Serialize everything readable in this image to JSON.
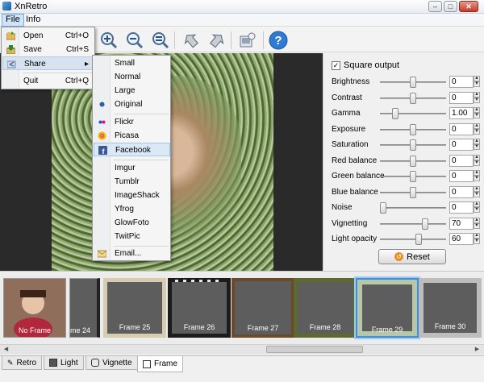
{
  "window": {
    "title": "XnRetro",
    "buttons": [
      "–",
      "□",
      "✕"
    ]
  },
  "menubar": {
    "file": "File",
    "info": "Info"
  },
  "file_menu": [
    {
      "label": "Open",
      "shortcut": "Ctrl+O",
      "icon": "folder-open-icon"
    },
    {
      "label": "Save",
      "shortcut": "Ctrl+S",
      "icon": "save-icon"
    },
    {
      "label": "Share",
      "shortcut": "▸",
      "icon": "share-icon"
    },
    {
      "label": "Quit",
      "shortcut": "Ctrl+Q",
      "icon": ""
    }
  ],
  "share_menu": {
    "sizes": [
      "Small",
      "Normal",
      "Large",
      "Original"
    ],
    "selected_size": "Original",
    "services_a": [
      "Flickr",
      "Picasa",
      "Facebook"
    ],
    "highlighted": "Facebook",
    "services_b": [
      "Imgur",
      "Tumblr",
      "ImageShack",
      "Yfrog",
      "GlowFoto",
      "TwitPic"
    ],
    "email": "Email..."
  },
  "toolbar": [
    "zoom-in-icon",
    "zoom-out-icon",
    "zoom-fit-icon",
    "rotate-left-icon",
    "rotate-right-icon",
    "export-icon",
    "help-icon"
  ],
  "panel": {
    "square_output_label": "Square output",
    "square_output_checked": true,
    "sliders": [
      {
        "label": "Brightness",
        "value": "0",
        "pos": 0.5
      },
      {
        "label": "Contrast",
        "value": "0",
        "pos": 0.5
      },
      {
        "label": "Gamma",
        "value": "1.00",
        "pos": 0.2
      },
      {
        "label": "Exposure",
        "value": "0",
        "pos": 0.5
      },
      {
        "label": "Saturation",
        "value": "0",
        "pos": 0.5
      },
      {
        "label": "Red balance",
        "value": "0",
        "pos": 0.5
      },
      {
        "label": "Green balance",
        "value": "0",
        "pos": 0.5
      },
      {
        "label": "Blue balance",
        "value": "0",
        "pos": 0.5
      },
      {
        "label": "Noise",
        "value": "0",
        "pos": 0.0
      },
      {
        "label": "Vignetting",
        "value": "70",
        "pos": 0.7
      },
      {
        "label": "Light opacity",
        "value": "60",
        "pos": 0.6
      }
    ],
    "reset_label": "Reset"
  },
  "frames": {
    "items": [
      "No Frame",
      "me 24",
      "Frame 25",
      "Frame 26",
      "Frame 27",
      "Frame 28",
      "Frame 29",
      "Frame 30"
    ],
    "selected": "Frame 29"
  },
  "tabs": [
    {
      "label": "Retro",
      "icon": "retro-icon"
    },
    {
      "label": "Light",
      "icon": "light-icon"
    },
    {
      "label": "Vignette",
      "icon": "vignette-icon"
    },
    {
      "label": "Frame",
      "icon": "frame-icon"
    }
  ],
  "active_tab": "Frame",
  "colors": {
    "accent": "#3a8ee6",
    "selection_blue": "#dbe8f6",
    "canvas_bg": "#2a2a2a"
  }
}
